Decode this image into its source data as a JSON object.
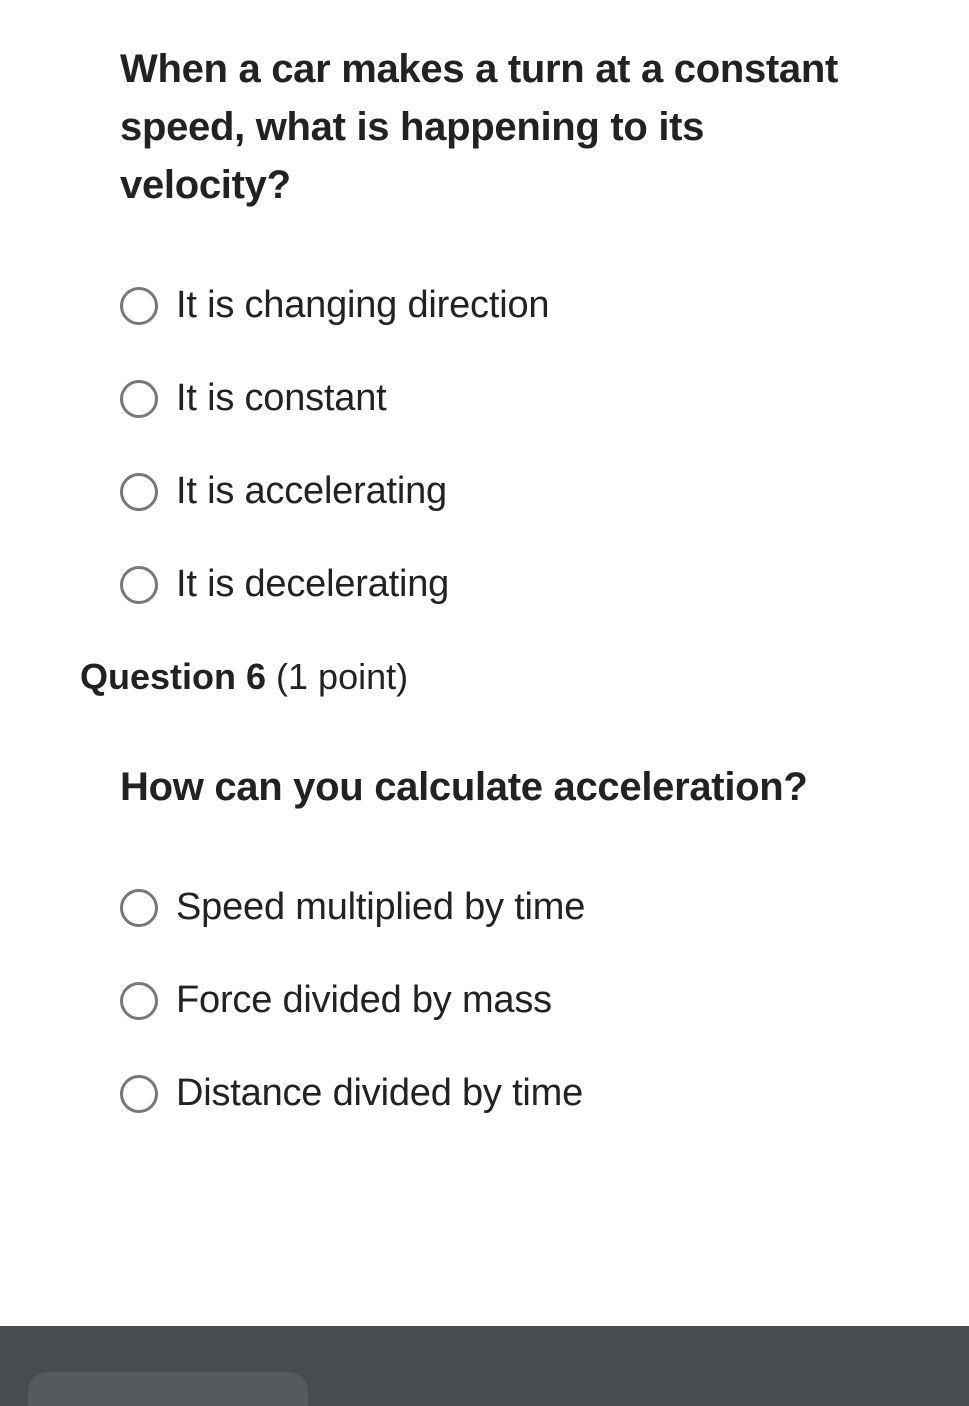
{
  "q5": {
    "text": "When a car makes a turn at a constant speed, what is happening to its velocity?",
    "options": [
      "It is changing direction",
      "It is constant",
      "It is accelerating",
      "It is decelerating"
    ]
  },
  "q6": {
    "header_label": "Question 6",
    "points_label": " (1 point)",
    "text": "How can you calculate acceleration?",
    "options": [
      "Speed multiplied by time",
      "Force divided by mass",
      "Distance divided by time"
    ]
  }
}
